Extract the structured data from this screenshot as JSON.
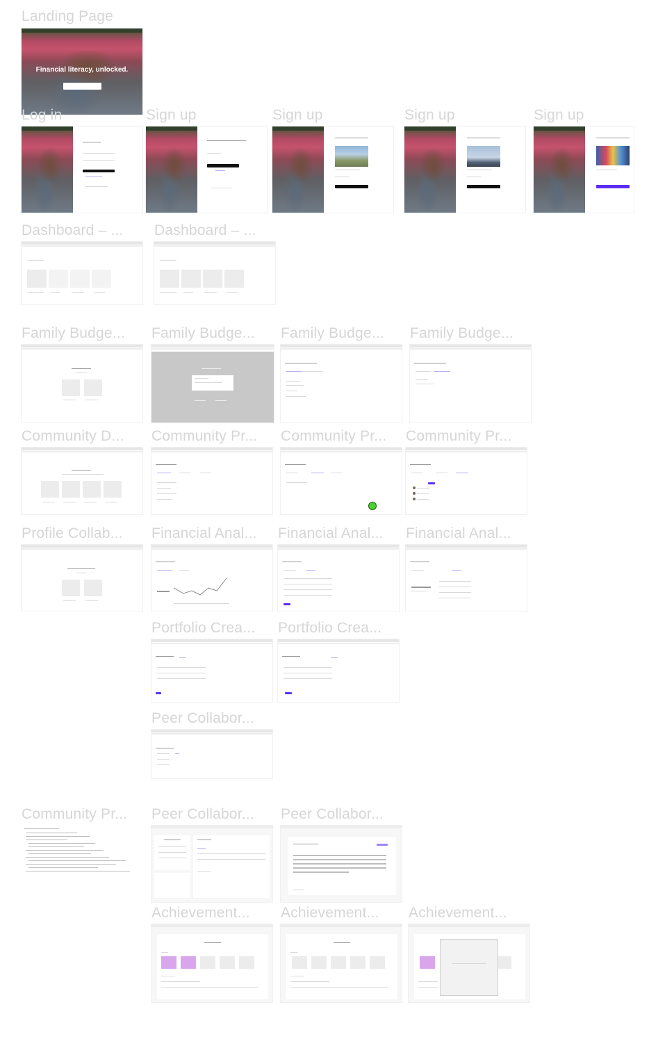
{
  "labels": {
    "landing": "Landing Page",
    "login": "Log in",
    "signup1": "Sign up",
    "signup2": "Sign up",
    "signup3": "Sign up",
    "signup4": "Sign up",
    "dash1": "Dashboard – ...",
    "dash2": "Dashboard – ...",
    "fb1": "Family Budge...",
    "fb2": "Family Budge...",
    "fb3": "Family Budge...",
    "fb4": "Family Budge...",
    "cd1": "Community D...",
    "cp1": "Community Pr...",
    "cp2": "Community Pr...",
    "cp3": "Community Pr...",
    "pc1": "Profile Collab...",
    "fa1": "Financial Anal...",
    "fa2": "Financial Anal...",
    "fa3": "Financial Anal...",
    "po1": "Portfolio Crea...",
    "po2": "Portfolio Crea...",
    "peer1": "Peer Collabor...",
    "cp4": "Community Pr...",
    "peer2": "Peer Collabor...",
    "peer3": "Peer Collabor...",
    "ach1": "Achievement...",
    "ach2": "Achievement...",
    "ach3": "Achievement..."
  },
  "hero": {
    "headline": "Financial literacy, unlocked."
  },
  "colors": {
    "accent": "#5b2ef2",
    "highlight": "#d9a6ee",
    "cursor_dot": "#4ad12f"
  }
}
